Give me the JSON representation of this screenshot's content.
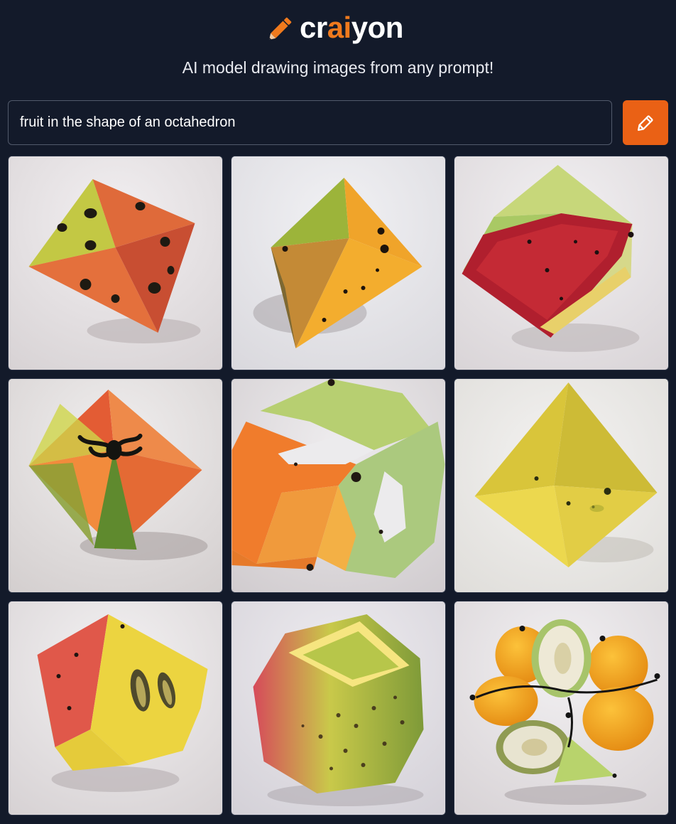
{
  "header": {
    "logo_prefix": "cr",
    "logo_accent": "ai",
    "logo_suffix": "yon",
    "tagline": "AI model drawing images from any prompt!"
  },
  "search": {
    "value": "fruit in the shape of an octahedron"
  },
  "draw_button": {
    "icon": "pencil-icon"
  },
  "colors": {
    "background": "#131a2a",
    "accent": "#f07a1d",
    "button": "#ea6115",
    "input_border": "#525a6b"
  },
  "results": [
    {
      "name": "result-image-1",
      "subject": "green and red octahedron fruit with black seeds"
    },
    {
      "name": "result-image-2",
      "subject": "orange and green octahedron fruit with black seeds"
    },
    {
      "name": "result-image-3",
      "subject": "watermelon octahedron with green rind"
    },
    {
      "name": "result-image-4",
      "subject": "orange and green octahedron fruit with black stem"
    },
    {
      "name": "result-image-5",
      "subject": "hollow frame fruit of orange and green melon"
    },
    {
      "name": "result-image-6",
      "subject": "yellow octahedron fruit"
    },
    {
      "name": "result-image-7",
      "subject": "yellow and red fruit with seed cavity"
    },
    {
      "name": "result-image-8",
      "subject": "hollow pink and green speckled fruit"
    },
    {
      "name": "result-image-9",
      "subject": "cluster of orange and white fruit pieces"
    }
  ]
}
